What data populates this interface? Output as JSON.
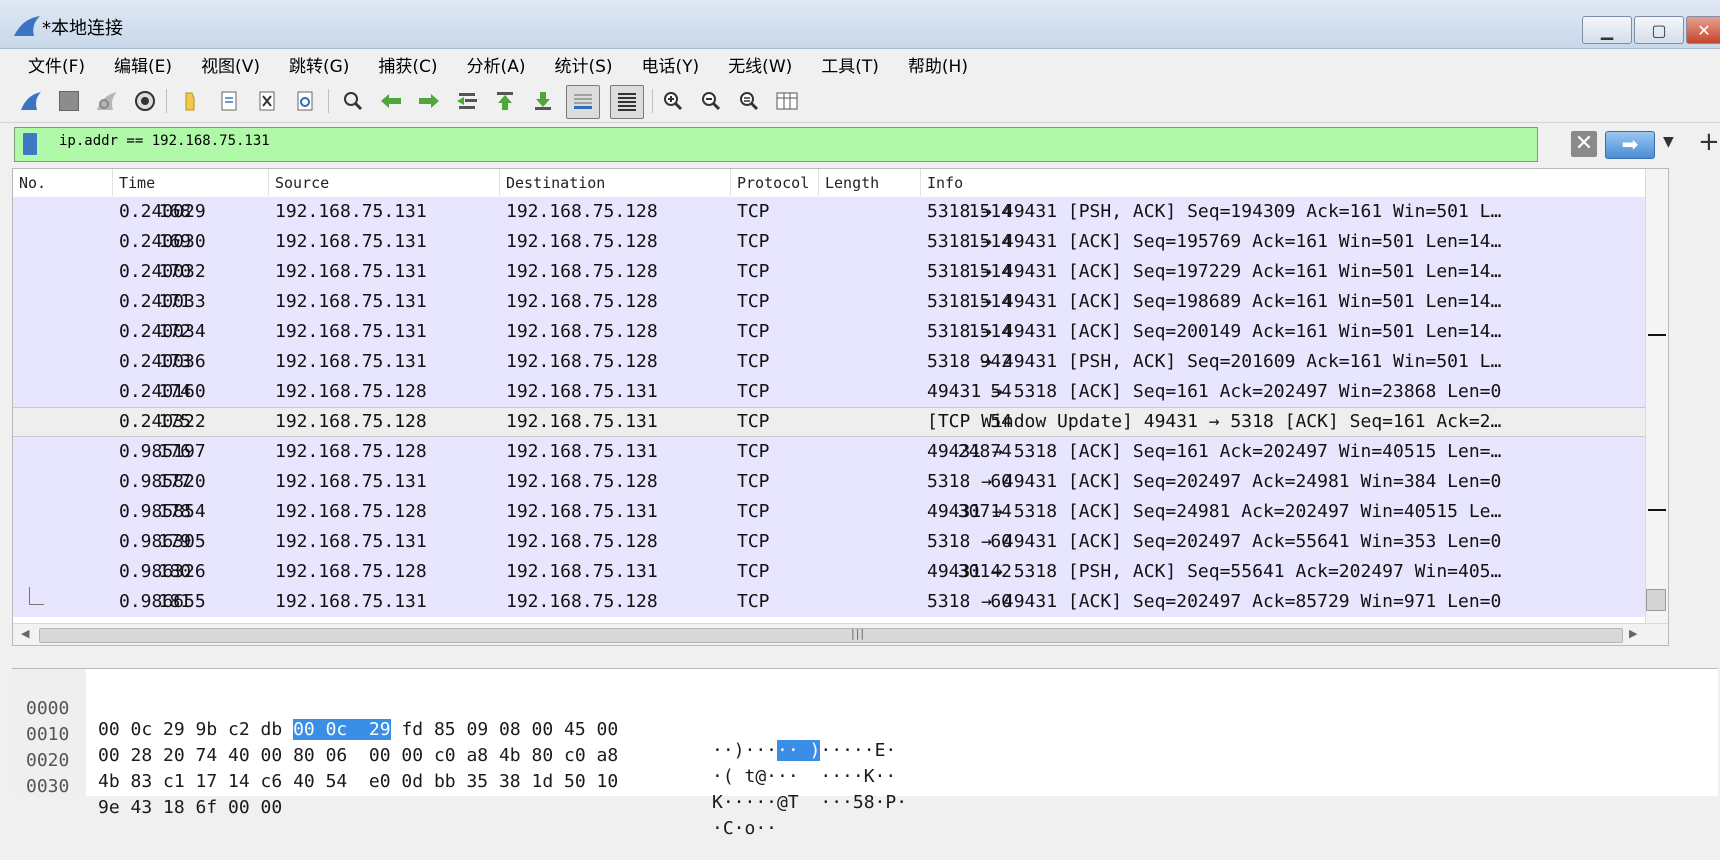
{
  "window": {
    "title": "*本地连接"
  },
  "menu": [
    "文件(F)",
    "编辑(E)",
    "视图(V)",
    "跳转(G)",
    "捕获(C)",
    "分析(A)",
    "统计(S)",
    "电话(Y)",
    "无线(W)",
    "工具(T)",
    "帮助(H)"
  ],
  "toolbar": {
    "icons": [
      "shark-fin-start-icon",
      "stop-capture-icon",
      "restart-capture-icon",
      "capture-options-icon",
      "open-file-icon",
      "save-file-icon",
      "close-file-icon",
      "reload-file-icon",
      "find-packet-icon",
      "go-back-icon",
      "go-forward-icon",
      "go-to-packet-icon",
      "go-first-packet-icon",
      "go-last-packet-icon",
      "autoscroll-icon",
      "colorize-icon",
      "zoom-in-icon",
      "zoom-out-icon",
      "normal-size-icon",
      "resize-columns-icon"
    ]
  },
  "filter": {
    "value": "ip.addr == 192.168.75.131"
  },
  "packet_list": {
    "columns": [
      "No.",
      "Time",
      "Source",
      "Destination",
      "Protocol",
      "Length",
      "Info"
    ],
    "selected_no": "175",
    "rows": [
      {
        "no": "168",
        "time": "0.240029",
        "src": "192.168.75.131",
        "dst": "192.168.75.128",
        "proto": "TCP",
        "len": "1514",
        "info": "5318 → 49431 [PSH, ACK] Seq=194309 Ack=161 Win=501 L…"
      },
      {
        "no": "169",
        "time": "0.240030",
        "src": "192.168.75.131",
        "dst": "192.168.75.128",
        "proto": "TCP",
        "len": "1514",
        "info": "5318 → 49431 [ACK] Seq=195769 Ack=161 Win=501 Len=14…"
      },
      {
        "no": "170",
        "time": "0.240032",
        "src": "192.168.75.131",
        "dst": "192.168.75.128",
        "proto": "TCP",
        "len": "1514",
        "info": "5318 → 49431 [ACK] Seq=197229 Ack=161 Win=501 Len=14…"
      },
      {
        "no": "171",
        "time": "0.240033",
        "src": "192.168.75.131",
        "dst": "192.168.75.128",
        "proto": "TCP",
        "len": "1514",
        "info": "5318 → 49431 [ACK] Seq=198689 Ack=161 Win=501 Len=14…"
      },
      {
        "no": "172",
        "time": "0.240034",
        "src": "192.168.75.131",
        "dst": "192.168.75.128",
        "proto": "TCP",
        "len": "1514",
        "info": "5318 → 49431 [ACK] Seq=200149 Ack=161 Win=501 Len=14…"
      },
      {
        "no": "173",
        "time": "0.240036",
        "src": "192.168.75.131",
        "dst": "192.168.75.128",
        "proto": "TCP",
        "len": "942",
        "info": "5318 → 49431 [PSH, ACK] Seq=201609 Ack=161 Win=501 L…"
      },
      {
        "no": "174",
        "time": "0.240160",
        "src": "192.168.75.128",
        "dst": "192.168.75.131",
        "proto": "TCP",
        "len": "54",
        "info": "49431 → 5318 [ACK] Seq=161 Ack=202497 Win=23868 Len=0"
      },
      {
        "no": "175",
        "time": "0.240322",
        "src": "192.168.75.128",
        "dst": "192.168.75.131",
        "proto": "TCP",
        "len": "54",
        "info": "[TCP Window Update] 49431 → 5318 [ACK] Seq=161 Ack=2…"
      },
      {
        "no": "176",
        "time": "0.985197",
        "src": "192.168.75.128",
        "dst": "192.168.75.131",
        "proto": "TCP",
        "len": "24874",
        "info": "49431 → 5318 [ACK] Seq=161 Ack=202497 Win=40515 Len=…"
      },
      {
        "no": "177",
        "time": "0.985820",
        "src": "192.168.75.131",
        "dst": "192.168.75.128",
        "proto": "TCP",
        "len": "60",
        "info": "5318 → 49431 [ACK] Seq=202497 Ack=24981 Win=384 Len=0"
      },
      {
        "no": "178",
        "time": "0.985854",
        "src": "192.168.75.128",
        "dst": "192.168.75.131",
        "proto": "TCP",
        "len": "30714",
        "info": "49431 → 5318 [ACK] Seq=24981 Ack=202497 Win=40515 Le…"
      },
      {
        "no": "179",
        "time": "0.986305",
        "src": "192.168.75.131",
        "dst": "192.168.75.128",
        "proto": "TCP",
        "len": "60",
        "info": "5318 → 49431 [ACK] Seq=202497 Ack=55641 Win=353 Len=0"
      },
      {
        "no": "180",
        "time": "0.986326",
        "src": "192.168.75.128",
        "dst": "192.168.75.131",
        "proto": "TCP",
        "len": "30142",
        "info": "49431 → 5318 [PSH, ACK] Seq=55641 Ack=202497 Win=405…"
      },
      {
        "no": "181",
        "time": "0.986655",
        "src": "192.168.75.131",
        "dst": "192.168.75.128",
        "proto": "TCP",
        "len": "60",
        "info": "5318 → 49431 [ACK] Seq=202497 Ack=85729 Win=971 Len=0"
      }
    ]
  },
  "bytes_pane": {
    "rows": [
      {
        "offset": "0000",
        "hex_pre": "00 0c 29 9b c2 db ",
        "hex_hl": "00 0c  29",
        "hex_post": " fd 85 09 08 00 45 00",
        "ascii_pre": "··)···",
        "ascii_hl": "·· )",
        "ascii_post": "·····E·"
      },
      {
        "offset": "0010",
        "hex_pre": "00 28 20 74 40 00 80 06  00 00 c0 a8 4b 80 c0 a8",
        "hex_hl": "",
        "hex_post": "",
        "ascii_pre": "·( t@···  ····K··",
        "ascii_hl": "",
        "ascii_post": ""
      },
      {
        "offset": "0020",
        "hex_pre": "4b 83 c1 17 14 c6 40 54  e0 0d bb 35 38 1d 50 10",
        "hex_hl": "",
        "hex_post": "",
        "ascii_pre": "K·····@T  ···58·P·",
        "ascii_hl": "",
        "ascii_post": ""
      },
      {
        "offset": "0030",
        "hex_pre": "9e 43 18 6f 00 00",
        "hex_hl": "",
        "hex_post": "",
        "ascii_pre": "·C·o··",
        "ascii_hl": "",
        "ascii_post": ""
      }
    ]
  }
}
